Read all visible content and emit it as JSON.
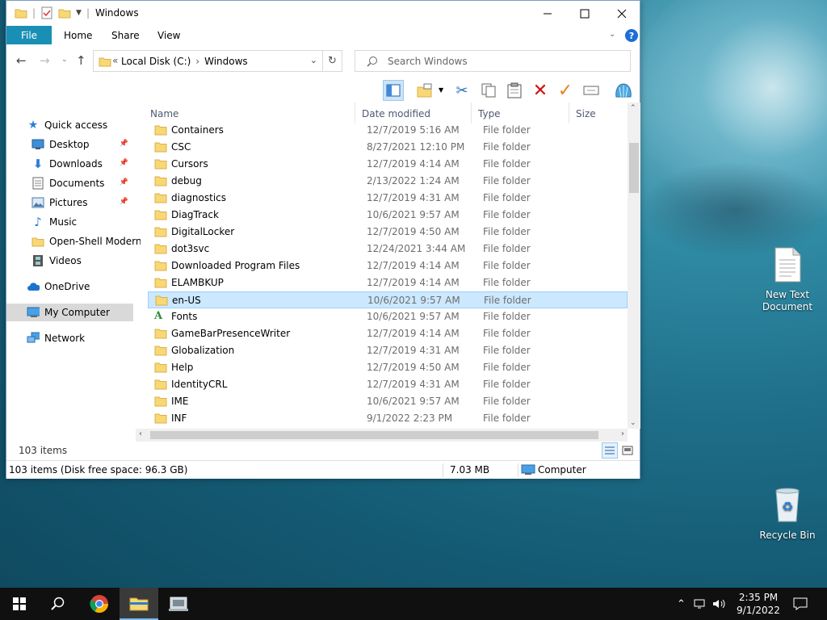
{
  "window": {
    "title": "Windows",
    "ribbon_tabs": {
      "file": "File",
      "home": "Home",
      "share": "Share",
      "view": "View"
    }
  },
  "address": {
    "chevron": "«",
    "segments": [
      "Local Disk (C:)",
      "Windows"
    ],
    "separator": "›"
  },
  "search": {
    "placeholder": "Search Windows"
  },
  "navpane": {
    "items": [
      {
        "label": "Quick access"
      },
      {
        "label": "Desktop"
      },
      {
        "label": "Downloads"
      },
      {
        "label": "Documents"
      },
      {
        "label": "Pictures"
      },
      {
        "label": "Music"
      },
      {
        "label": "Open-Shell Modern"
      },
      {
        "label": "Videos"
      },
      {
        "label": "OneDrive"
      },
      {
        "label": "My Computer"
      },
      {
        "label": "Network"
      }
    ]
  },
  "columns": {
    "name": "Name",
    "date": "Date modified",
    "type": "Type",
    "size": "Size"
  },
  "files": [
    {
      "name": "Containers",
      "date": "12/7/2019 5:16 AM",
      "type": "File folder"
    },
    {
      "name": "CSC",
      "date": "8/27/2021 12:10 PM",
      "type": "File folder"
    },
    {
      "name": "Cursors",
      "date": "12/7/2019 4:14 AM",
      "type": "File folder"
    },
    {
      "name": "debug",
      "date": "2/13/2022 1:24 AM",
      "type": "File folder"
    },
    {
      "name": "diagnostics",
      "date": "12/7/2019 4:31 AM",
      "type": "File folder"
    },
    {
      "name": "DiagTrack",
      "date": "10/6/2021 9:57 AM",
      "type": "File folder"
    },
    {
      "name": "DigitalLocker",
      "date": "12/7/2019 4:50 AM",
      "type": "File folder"
    },
    {
      "name": "dot3svc",
      "date": "12/24/2021 3:44 AM",
      "type": "File folder"
    },
    {
      "name": "Downloaded Program Files",
      "date": "12/7/2019 4:14 AM",
      "type": "File folder"
    },
    {
      "name": "ELAMBKUP",
      "date": "12/7/2019 4:14 AM",
      "type": "File folder"
    },
    {
      "name": "en-US",
      "date": "10/6/2021 9:57 AM",
      "type": "File folder"
    },
    {
      "name": "Fonts",
      "date": "10/6/2021 9:57 AM",
      "type": "File folder"
    },
    {
      "name": "GameBarPresenceWriter",
      "date": "12/7/2019 4:14 AM",
      "type": "File folder"
    },
    {
      "name": "Globalization",
      "date": "12/7/2019 4:31 AM",
      "type": "File folder"
    },
    {
      "name": "Help",
      "date": "12/7/2019 4:50 AM",
      "type": "File folder"
    },
    {
      "name": "IdentityCRL",
      "date": "12/7/2019 4:31 AM",
      "type": "File folder"
    },
    {
      "name": "IME",
      "date": "10/6/2021 9:57 AM",
      "type": "File folder"
    },
    {
      "name": "INF",
      "date": "9/1/2022 2:23 PM",
      "type": "File folder"
    }
  ],
  "status": {
    "items_count": "103 items",
    "summary": "103 items (Disk free space: 96.3 GB)",
    "size": "7.03 MB",
    "location": "Computer"
  },
  "desktop_icons": {
    "text_document": "New Text Document",
    "recycle_bin": "Recycle Bin"
  },
  "clock": {
    "time": "2:35 PM",
    "date": "9/1/2022"
  },
  "colors": {
    "file_tab": "#1a8fb5",
    "selection": "#cce8ff",
    "folder": "#f8d775"
  }
}
